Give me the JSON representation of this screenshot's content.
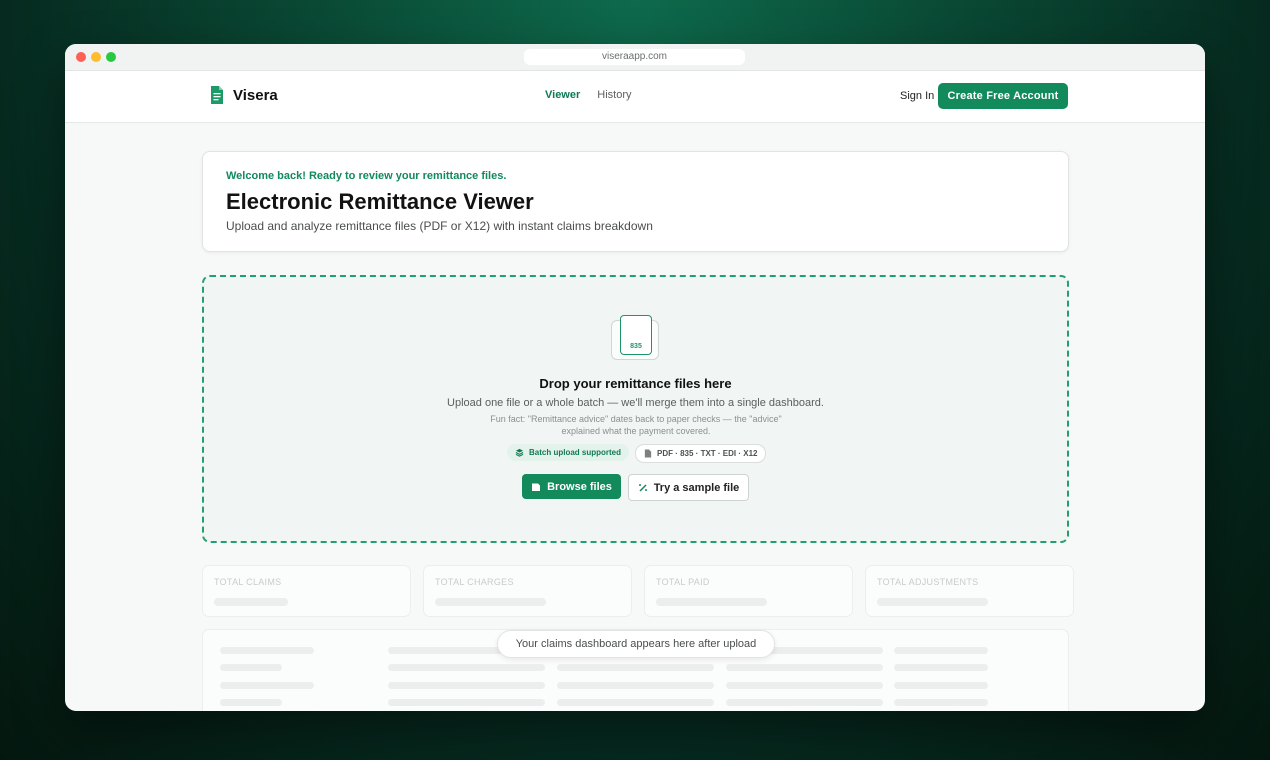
{
  "browser": {
    "url": "viseraapp.com"
  },
  "nav": {
    "brand": "Visera",
    "links": [
      {
        "label": "Viewer",
        "active": true
      },
      {
        "label": "History",
        "active": false
      }
    ],
    "signin": "Sign In",
    "cta": "Create Free Account"
  },
  "header": {
    "welcome": "Welcome back! Ready to review your remittance files.",
    "title": "Electronic Remittance Viewer",
    "subtitle": "Upload and analyze remittance files (PDF or X12) with instant claims breakdown"
  },
  "dropzone": {
    "doc_label": "835",
    "title": "Drop your remittance files here",
    "subtitle": "Upload one file or a whole batch — we'll merge them into a single dashboard.",
    "fun_fact": "Fun fact: \"Remittance advice\" dates back to paper checks — the \"advice\" explained what the payment covered.",
    "pill_batch": "Batch upload supported",
    "pill_formats": "PDF · 835 · TXT · EDI · X12",
    "browse": "Browse files",
    "sample": "Try a sample file"
  },
  "stats": [
    {
      "label": "TOTAL CLAIMS"
    },
    {
      "label": "TOTAL CHARGES"
    },
    {
      "label": "TOTAL PAID"
    },
    {
      "label": "TOTAL ADJUSTMENTS"
    }
  ],
  "dashboard": {
    "placeholder": "Your claims dashboard appears here after upload"
  },
  "colors": {
    "accent": "#128a5c",
    "accent_text": "#0e7a53",
    "background": "#062a1f"
  }
}
